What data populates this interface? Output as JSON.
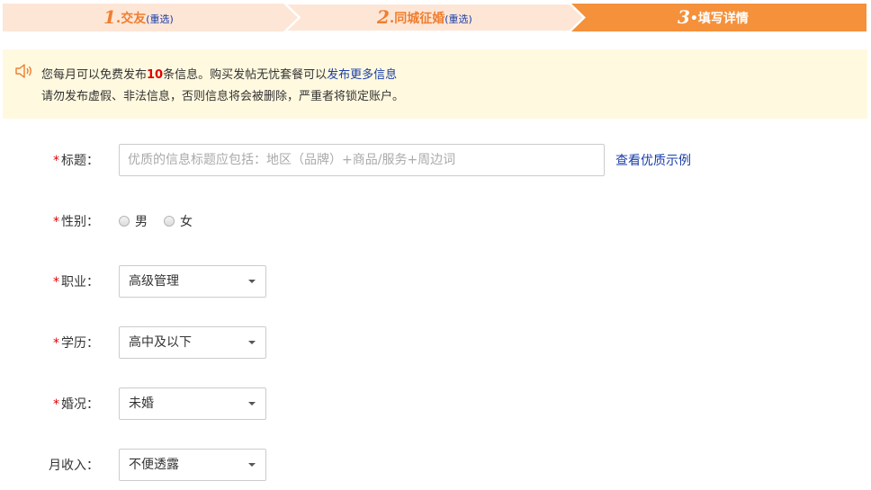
{
  "steps": [
    {
      "num": "1",
      "dot": ".",
      "label": "交友",
      "redo": "(重选)",
      "state": "done"
    },
    {
      "num": "2",
      "dot": ".",
      "label": "同城征婚",
      "redo": "(重选)",
      "state": "done"
    },
    {
      "num": "3",
      "dot": "•",
      "label": "填写详情",
      "redo": "",
      "state": "active"
    }
  ],
  "colors": {
    "step_done_bg": "#fde6d6",
    "step_active_bg": "#f5913a",
    "step_text": "#f07d2e",
    "notice_bg": "#fff9df",
    "required": "#e00000",
    "link": "#1a3ea8"
  },
  "notice": {
    "icon": "speaker-icon",
    "line1_prefix": "您每月可以免费发布",
    "line1_count": "10",
    "line1_middle": "条信息。购买发帖无忧套餐可以",
    "line1_link": "发布更多信息",
    "line2": "请勿发布虚假、非法信息，否则信息将会被删除，严重者将锁定账户。"
  },
  "form": {
    "required_mark": "*",
    "title": {
      "label": "标题：",
      "placeholder": "优质的信息标题应包括：地区（品牌）+商品/服务+周边词",
      "value": "",
      "example_link": "查看优质示例"
    },
    "gender": {
      "label": "性别：",
      "options": [
        "男",
        "女"
      ]
    },
    "occupation": {
      "label": "职业：",
      "value": "高级管理"
    },
    "education": {
      "label": "学历：",
      "value": "高中及以下"
    },
    "marital": {
      "label": "婚况：",
      "value": "未婚"
    },
    "income": {
      "label": "月收入：",
      "value": "不便透露"
    }
  }
}
